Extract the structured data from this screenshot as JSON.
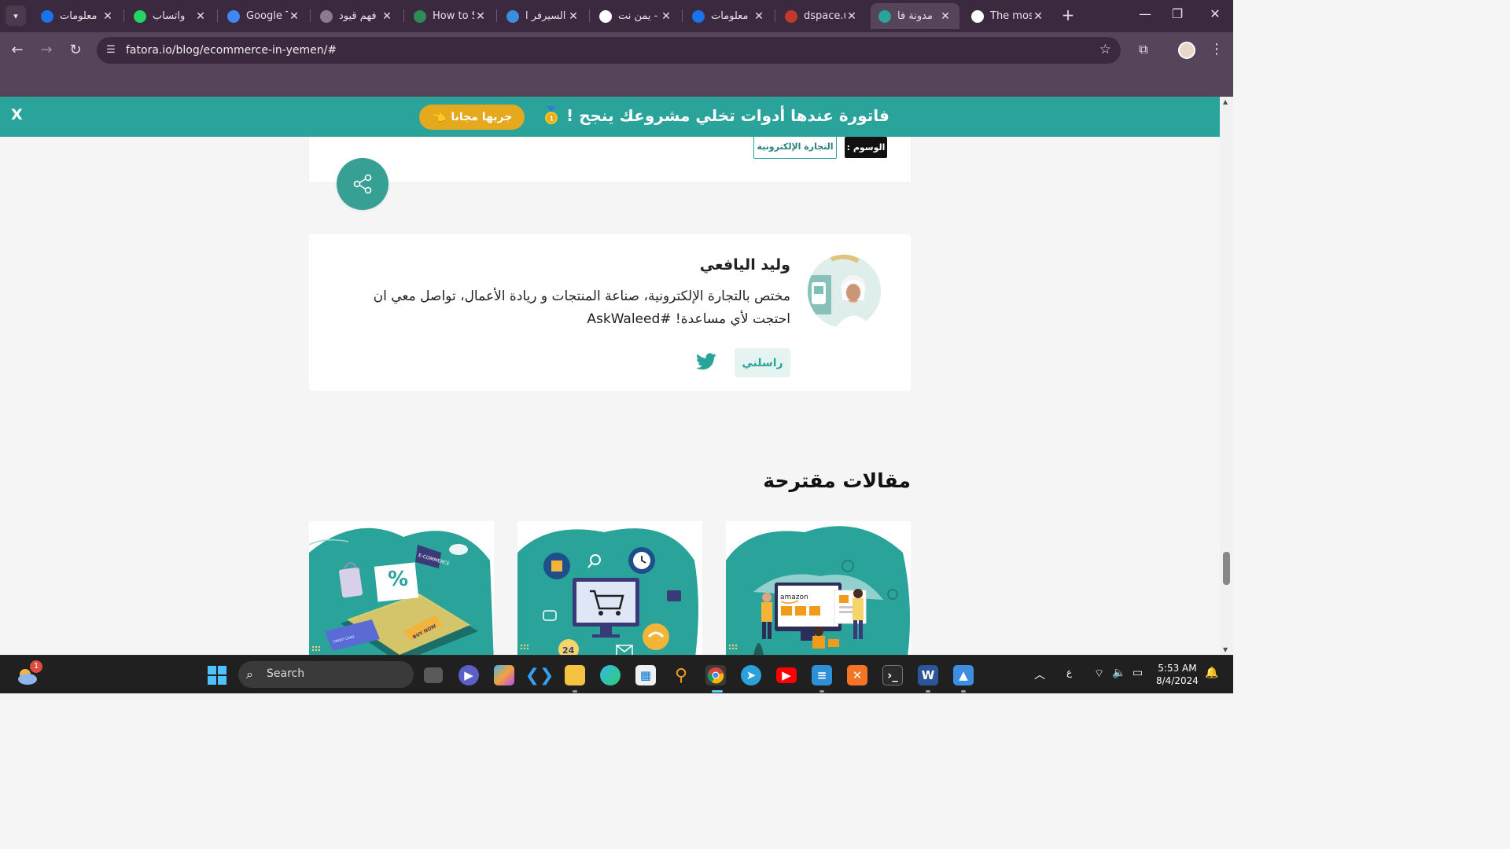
{
  "browser": {
    "tabs": [
      {
        "title": "معلومات",
        "favicon_color": "#1a73e8"
      },
      {
        "title": "واتساب",
        "favicon_color": "#25d366"
      },
      {
        "title": "Google T",
        "favicon_color": "#4285f4"
      },
      {
        "title": "فهم قيود",
        "favicon_color": "#8a7b8e"
      },
      {
        "title": "How to S",
        "favicon_color": "#2e8b57"
      },
      {
        "title": "السيرفر ا",
        "favicon_color": "#3c8dde"
      },
      {
        "title": "يمن نت -",
        "favicon_color": "#ffffff"
      },
      {
        "title": "معلومات",
        "favicon_color": "#1a73e8"
      },
      {
        "title": "dspace.u",
        "favicon_color": "#c0392b"
      },
      {
        "title": "مدونة فا",
        "favicon_color": "#2aa39a"
      },
      {
        "title": "The mos",
        "favicon_color": "#ffffff"
      }
    ],
    "active_tab_index": 9,
    "url": "fatora.io/blog/ecommerce-in-yemen/#"
  },
  "promo": {
    "close_label": "X",
    "cta_label": "جربها مجانا",
    "message": "فاتورة عندها أدوات تخلي مشروعك ينجح !"
  },
  "tags": {
    "label": "الوسوم :",
    "items": [
      "التجارة الإلكترونية"
    ]
  },
  "author": {
    "name": "وليد اليافعي",
    "bio": "مختص بالتجارة الإلكترونية، صناعة المنتجات و ريادة الأعمال، تواصل معي ان احتجت لأي مساعدة! #AskWaleed",
    "contact_label": "راسلني"
  },
  "suggested": {
    "title": "مقالات مقترحة",
    "articles": [
      {
        "illustration": "ecommerce-shopping-illustration",
        "labels": [
          "E-COMMERCE",
          "BUY NOW",
          "CREDIT CARD"
        ]
      },
      {
        "illustration": "online-cart-illustration",
        "labels": [
          "24"
        ]
      },
      {
        "illustration": "amazon-marketplace-illustration",
        "labels": [
          "amazon"
        ]
      }
    ]
  },
  "taskbar": {
    "search_label": "Search",
    "weather_badge": "1",
    "time": "5:53 AM",
    "date": "8/4/2024",
    "lang": "ع"
  },
  "colors": {
    "brand_teal": "#2aa39a",
    "cta_yellow": "#e6a81c",
    "chrome_dark": "#3b2a3f",
    "chrome_mid": "#55445a"
  }
}
